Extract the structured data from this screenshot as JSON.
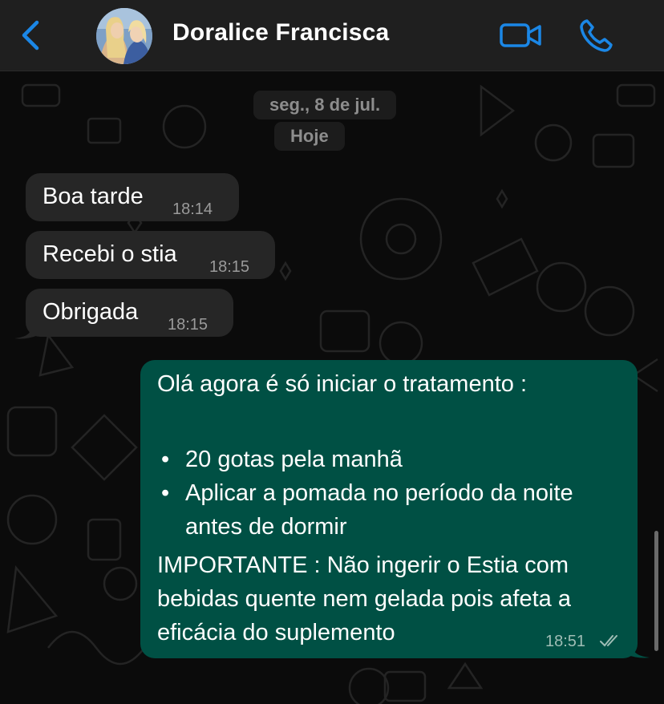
{
  "header": {
    "contact_name": "Doralice Francisca",
    "back_icon": "chevron-left-icon",
    "video_icon": "video-camera-icon",
    "call_icon": "phone-icon",
    "accent_color": "#1b87e6"
  },
  "date_chips": [
    "seg., 8 de jul.",
    "Hoje"
  ],
  "incoming": [
    {
      "text": "Boa tarde",
      "time": "18:14"
    },
    {
      "text": "Recebi o stia",
      "time": "18:15"
    },
    {
      "text": "Obrigada",
      "time": "18:15"
    }
  ],
  "outgoing": {
    "intro": "Olá agora é só iniciar o tratamento :",
    "bullets": [
      "20 gotas pela manhã",
      "Aplicar a pomada no período da noite",
      "antes de dormir"
    ],
    "important_lines": [
      "IMPORTANTE : Não ingerir o Estia com",
      "bebidas quente nem gelada pois afeta a",
      "eficácia  do suplemento"
    ],
    "time": "18:51",
    "status_icon": "double-check-icon"
  },
  "colors": {
    "incoming_bubble": "#262626",
    "outgoing_bubble": "#005044",
    "background": "#0b0b0b"
  }
}
